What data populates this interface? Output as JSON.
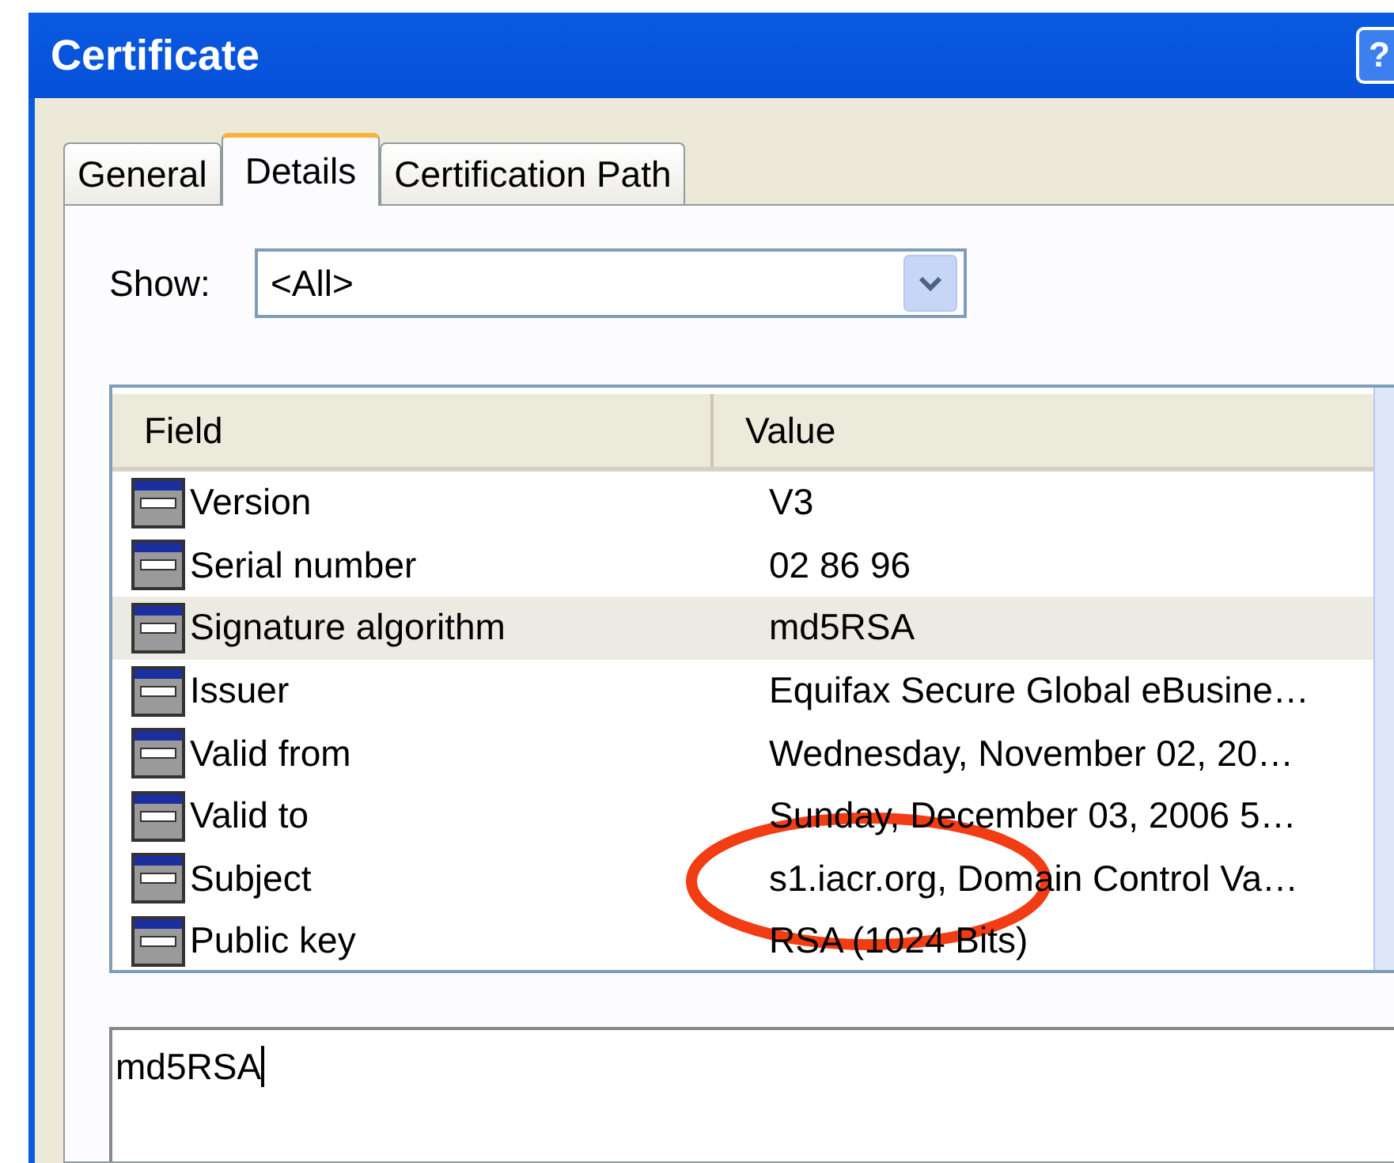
{
  "window": {
    "title": "Certificate",
    "help_button": "?"
  },
  "tabs": [
    {
      "label": "General",
      "selected": false
    },
    {
      "label": "Details",
      "selected": true
    },
    {
      "label": "Certification Path",
      "selected": false
    }
  ],
  "show": {
    "label": "Show:",
    "value": "<All>"
  },
  "table": {
    "columns": [
      "Field",
      "Value"
    ],
    "rows": [
      {
        "field": "Version",
        "value": "V3",
        "selected": false
      },
      {
        "field": "Serial number",
        "value": "02 86 96",
        "selected": false
      },
      {
        "field": "Signature algorithm",
        "value": "md5RSA",
        "selected": true
      },
      {
        "field": "Issuer",
        "value": "Equifax Secure Global eBusine…",
        "selected": false
      },
      {
        "field": "Valid from",
        "value": "Wednesday, November 02, 20…",
        "selected": false
      },
      {
        "field": "Valid to",
        "value": "Sunday, December 03, 2006 5…",
        "selected": false
      },
      {
        "field": "Subject",
        "value": "s1.iacr.org, Domain Control Va…",
        "selected": false
      },
      {
        "field": "Public key",
        "value": "RSA (1024 Bits)",
        "selected": false
      }
    ]
  },
  "value_box": {
    "value": "md5RSA"
  },
  "annotation": {
    "kind": "ellipse"
  }
}
